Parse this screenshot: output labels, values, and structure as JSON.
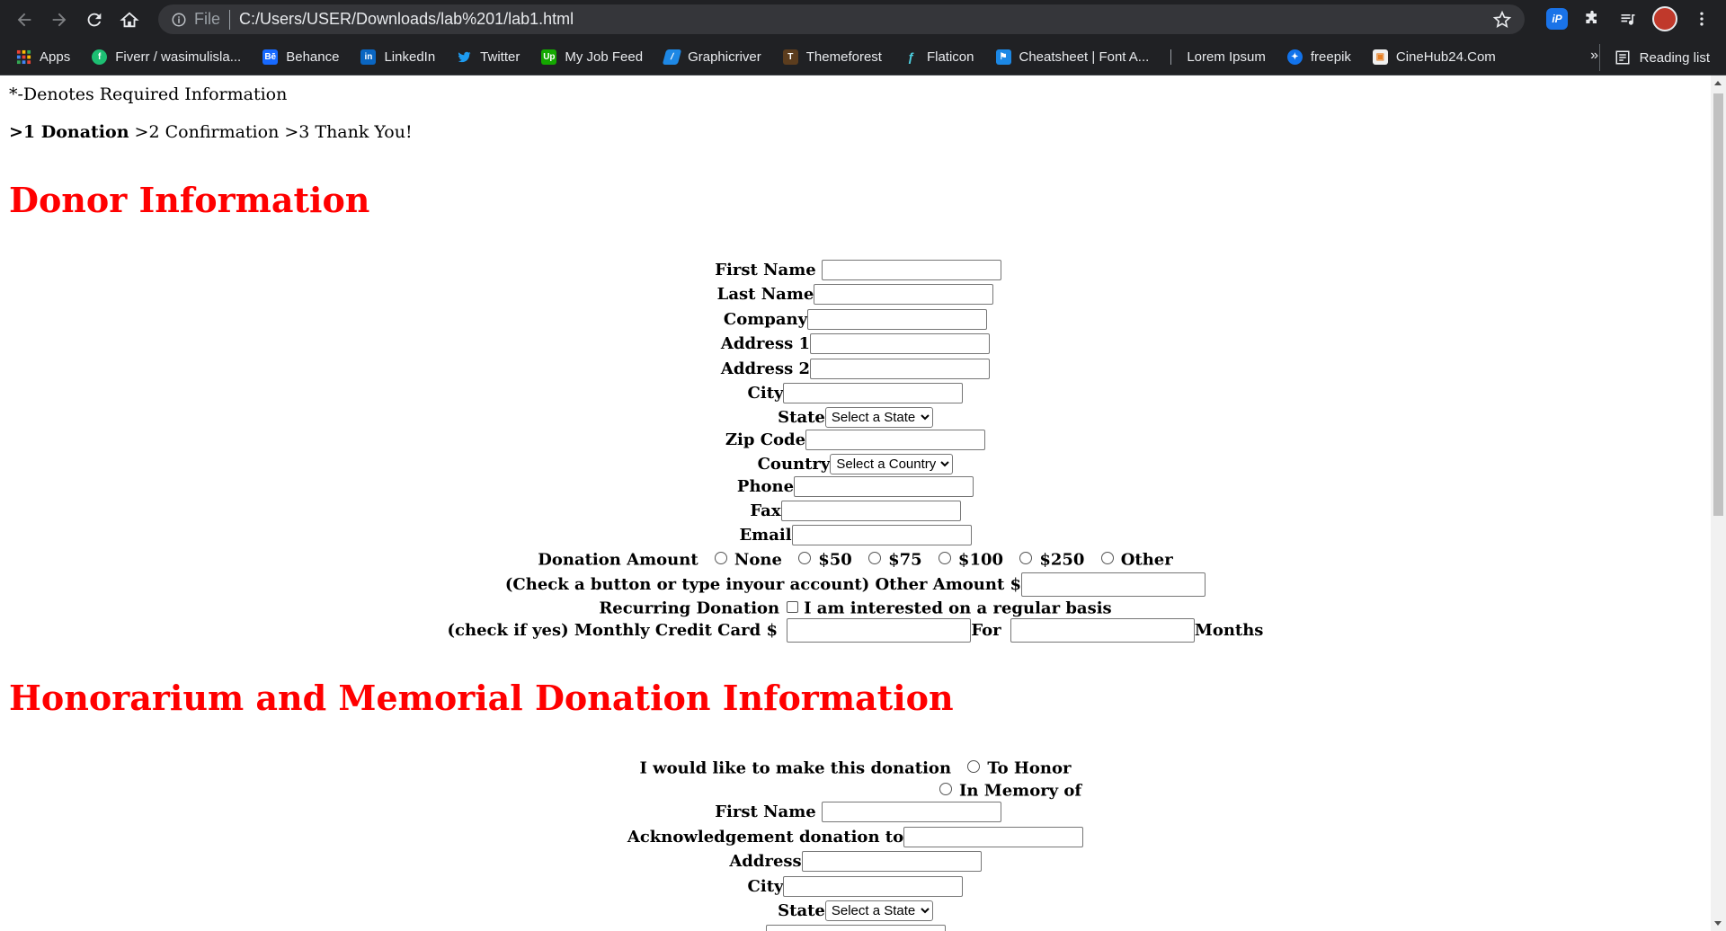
{
  "browser": {
    "address": {
      "scheme_label": "File",
      "url": "C:/Users/USER/Downloads/lab%201/lab1.html"
    },
    "extensions": {
      "ip_label": "iP"
    },
    "bookmarks": [
      {
        "label": "Apps",
        "icon": "apps-grid-icon",
        "color": "#ea4335"
      },
      {
        "label": "Fiverr / wasimulisla...",
        "icon": "fiverr-icon",
        "color": "#1dbf73"
      },
      {
        "label": "Behance",
        "icon": "behance-icon",
        "color": "#1769ff"
      },
      {
        "label": "LinkedIn",
        "icon": "linkedin-icon",
        "color": "#0a66c2"
      },
      {
        "label": "Twitter",
        "icon": "twitter-icon",
        "color": "#1d9bf0"
      },
      {
        "label": "My Job Feed",
        "icon": "upwork-icon",
        "color": "#14a800"
      },
      {
        "label": "Graphicriver",
        "icon": "graphicriver-icon",
        "color": "#1e88e5"
      },
      {
        "label": "Themeforest",
        "icon": "themeforest-icon",
        "color": "#5c3d1e"
      },
      {
        "label": "Flaticon",
        "icon": "flaticon-icon",
        "color": "#0e2a47"
      },
      {
        "label": "Cheatsheet | Font A...",
        "icon": "fontawesome-icon",
        "color": "#1c88e5"
      },
      {
        "label": "Lorem Ipsum",
        "icon": "lorem-icon",
        "color": "#202124"
      },
      {
        "label": "freepik",
        "icon": "freepik-icon",
        "color": "#1273eb"
      },
      {
        "label": "CineHub24.Com",
        "icon": "cinehub-icon",
        "color": "#f0f0f0"
      }
    ],
    "more_label": "»",
    "reading_list_label": "Reading list"
  },
  "page": {
    "required_note": "*-Denotes Required Information",
    "steps": {
      "current": ">1 Donation",
      "rest": " >2 Confirmation >3 Thank You!"
    },
    "donor_section": {
      "title": "Donor Information",
      "labels": {
        "first_name": "First Name",
        "last_name": "Last Name",
        "company": "Company",
        "address1": "Address 1",
        "address2": "Address 2",
        "city": "City",
        "state": "State",
        "zip": "Zip Code",
        "country": "Country",
        "phone": "Phone",
        "fax": "Fax",
        "email": "Email"
      },
      "state_select": "Select a State",
      "country_select": "Select a Country",
      "donation_amount": {
        "label": "Donation Amount",
        "options": [
          "None",
          "$50",
          "$75",
          "$100",
          "$250",
          "Other"
        ]
      },
      "other_amount_label": "(Check a button or type inyour account) Other Amount $",
      "recurring": {
        "label": "Recurring Donation",
        "checkbox_label": "I am interested on a regular basis"
      },
      "monthly": {
        "label": "(check if yes) Monthly Credit Card $",
        "for_label": "For",
        "months_label": "Months"
      }
    },
    "honor_section": {
      "title": "Honorarium and Memorial Donation Information",
      "prompt": "I would like to make this donation",
      "options": [
        "To Honor",
        "In Memory of"
      ],
      "labels": {
        "first_name": "First Name",
        "acknowledgement": "Acknowledgement donation to",
        "address": "Address",
        "city": "City",
        "state": "State"
      },
      "state_select": "Select a State"
    }
  }
}
